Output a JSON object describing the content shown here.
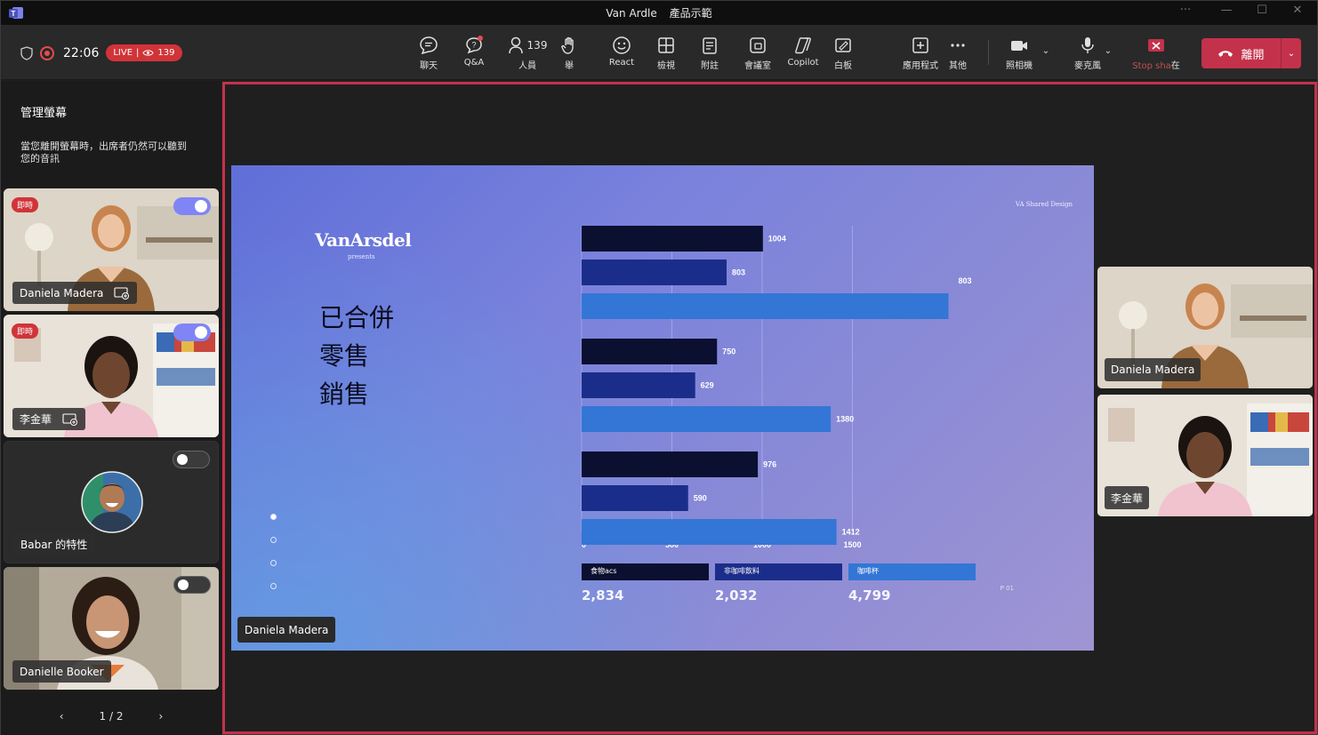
{
  "window": {
    "title": "Van Ardle",
    "subtitle": "產品示範"
  },
  "meeting": {
    "time": "22:06",
    "live_label": "LIVE",
    "viewers": "139"
  },
  "toolbar": {
    "chat": "聊天",
    "qa": "Q&A",
    "people": "人員",
    "people_count": "139",
    "raise": "舉",
    "react": "React",
    "view": "檢視",
    "notes": "附註",
    "rooms": "會議室",
    "copilot": "Copilot",
    "whiteboard": "白板",
    "apps": "應用程式",
    "more": "其他",
    "camera": "照相機",
    "mic": "麥克風",
    "stop_share": "Stop sha",
    "stop_share_tail": "在",
    "leave": "離開"
  },
  "left_panel": {
    "title": "管理螢幕",
    "description": "當您離開螢幕時，出席者仍然可以聽到您的音訊",
    "live_tag": "即時",
    "participants": [
      {
        "name": "Daniela Madera",
        "on": true,
        "live": true
      },
      {
        "name": "李金華",
        "on": true,
        "live": true
      },
      {
        "name": "Babar 的特性",
        "on": false,
        "live": false
      },
      {
        "name": "Danielle Booker",
        "on": false,
        "live": false
      }
    ],
    "pager": "1 / 2"
  },
  "slide": {
    "brand": "VanArsdel",
    "presents": "presents",
    "title_lines": [
      "已合併",
      "零售",
      "銷售"
    ],
    "design_tag": "VA Shared Design",
    "page": "P 01",
    "summary": [
      {
        "label": "食物acs",
        "value": "2,834",
        "color": "#0b1030"
      },
      {
        "label": "非咖啡飲料",
        "value": "2,032",
        "color": "#1b2d8a"
      },
      {
        "label": "咖啡杯",
        "value": "4,799",
        "color": "#3376d6"
      }
    ]
  },
  "stage": {
    "presenter": "Daniela Madera",
    "side_participants": [
      "Daniela Madera",
      "李金華"
    ]
  },
  "chart_data": {
    "type": "bar",
    "orientation": "horizontal",
    "groups": 3,
    "series": [
      {
        "name": "食物acs",
        "color": "#0b1030",
        "values": [
          1004,
          750,
          976
        ]
      },
      {
        "name": "非咖啡飲料",
        "color": "#1b2d8a",
        "values": [
          803,
          629,
          590
        ]
      },
      {
        "name": "咖啡杯",
        "color": "#3376d6",
        "values": [
          2032,
          1380,
          1412
        ]
      }
    ],
    "data_labels": [
      "1004",
      "803",
      "803",
      "750",
      "629",
      "1380",
      "976",
      "590",
      "1412"
    ],
    "x_ticks": [
      "0",
      "500",
      "1000",
      "1500"
    ],
    "xlim": [
      0,
      2100
    ],
    "grid": true
  }
}
